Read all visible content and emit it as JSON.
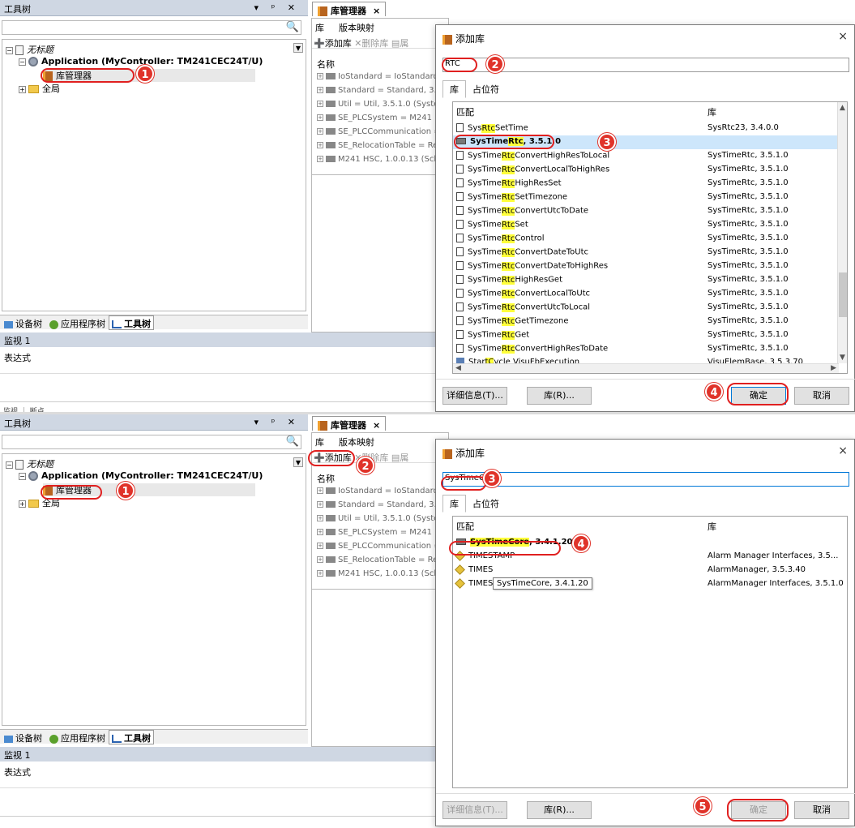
{
  "shared": {
    "tool_tree_title": "工具树",
    "pin_close": "▾  ᵖ  ✕",
    "project_name": "无标题",
    "application_node": "Application (MyController: TM241CEC24T/U)",
    "library_manager_node": "库管理器",
    "global_node": "全局",
    "tab_device_tree": "设备树",
    "tab_app_tree": "应用程序树",
    "tab_tool_tree": "工具树",
    "watch_title": "监视 1",
    "watch_col": "表达式",
    "lm_tab_title": "库管理器",
    "lm_subtab_lib": "库",
    "lm_subtab_version": "版本映射",
    "lm_add_lib": "添加库",
    "lm_remove_lib": "删除库",
    "lm_props": "属",
    "lm_name_header": "名称",
    "lm_items": [
      "IoStandard = IoStandard",
      "Standard = Standard, 3.5",
      "Util = Util, 3.5.1.0 (Syster",
      "SE_PLCSystem = M241 Pl",
      "SE_PLCCommunication =",
      "SE_RelocationTable = Re",
      "M241 HSC, 1.0.0.13 (Schn"
    ],
    "dlg_title": "添加库",
    "dlg_close": "×",
    "dlg_tab_lib": "库",
    "dlg_tab_placeholder": "占位符",
    "col_match": "匹配",
    "col_lib": "库",
    "btn_details": "详细信息(T)...",
    "btn_lib": "库(R)...",
    "btn_ok": "确定",
    "btn_cancel": "取消"
  },
  "panel1": {
    "search_text": "RTC",
    "rows": [
      {
        "icon": "doc",
        "pre": "Sys",
        "hl": "Rtc",
        "post": "SetTime",
        "lib": "SysRtc23, 3.4.0.0",
        "sel": false,
        "bold": false
      },
      {
        "icon": "lib",
        "pre": "SysTime",
        "hl": "Rtc",
        "post": ", 3.5.1.0",
        "lib": "",
        "sel": true,
        "bold": true
      },
      {
        "icon": "doc",
        "pre": "SysTime",
        "hl": "Rtc",
        "post": "ConvertHighResToLocal",
        "lib": "SysTimeRtc, 3.5.1.0",
        "sel": false,
        "bold": false
      },
      {
        "icon": "doc",
        "pre": "SysTime",
        "hl": "Rtc",
        "post": "ConvertLocalToHighRes",
        "lib": "SysTimeRtc, 3.5.1.0",
        "sel": false,
        "bold": false
      },
      {
        "icon": "doc",
        "pre": "SysTime",
        "hl": "Rtc",
        "post": "HighResSet",
        "lib": "SysTimeRtc, 3.5.1.0",
        "sel": false,
        "bold": false
      },
      {
        "icon": "doc",
        "pre": "SysTime",
        "hl": "Rtc",
        "post": "SetTimezone",
        "lib": "SysTimeRtc, 3.5.1.0",
        "sel": false,
        "bold": false
      },
      {
        "icon": "doc",
        "pre": "SysTime",
        "hl": "Rtc",
        "post": "ConvertUtcToDate",
        "lib": "SysTimeRtc, 3.5.1.0",
        "sel": false,
        "bold": false
      },
      {
        "icon": "doc",
        "pre": "SysTime",
        "hl": "Rtc",
        "post": "Set",
        "lib": "SysTimeRtc, 3.5.1.0",
        "sel": false,
        "bold": false
      },
      {
        "icon": "doc",
        "pre": "SysTime",
        "hl": "Rtc",
        "post": "Control",
        "lib": "SysTimeRtc, 3.5.1.0",
        "sel": false,
        "bold": false
      },
      {
        "icon": "doc",
        "pre": "SysTime",
        "hl": "Rtc",
        "post": "ConvertDateToUtc",
        "lib": "SysTimeRtc, 3.5.1.0",
        "sel": false,
        "bold": false
      },
      {
        "icon": "doc",
        "pre": "SysTime",
        "hl": "Rtc",
        "post": "ConvertDateToHighRes",
        "lib": "SysTimeRtc, 3.5.1.0",
        "sel": false,
        "bold": false
      },
      {
        "icon": "doc",
        "pre": "SysTime",
        "hl": "Rtc",
        "post": "HighResGet",
        "lib": "SysTimeRtc, 3.5.1.0",
        "sel": false,
        "bold": false
      },
      {
        "icon": "doc",
        "pre": "SysTime",
        "hl": "Rtc",
        "post": "ConvertLocalToUtc",
        "lib": "SysTimeRtc, 3.5.1.0",
        "sel": false,
        "bold": false
      },
      {
        "icon": "doc",
        "pre": "SysTime",
        "hl": "Rtc",
        "post": "ConvertUtcToLocal",
        "lib": "SysTimeRtc, 3.5.1.0",
        "sel": false,
        "bold": false
      },
      {
        "icon": "doc",
        "pre": "SysTime",
        "hl": "Rtc",
        "post": "GetTimezone",
        "lib": "SysTimeRtc, 3.5.1.0",
        "sel": false,
        "bold": false
      },
      {
        "icon": "doc",
        "pre": "SysTime",
        "hl": "Rtc",
        "post": "Get",
        "lib": "SysTimeRtc, 3.5.1.0",
        "sel": false,
        "bold": false
      },
      {
        "icon": "doc",
        "pre": "SysTime",
        "hl": "Rtc",
        "post": "ConvertHighResToDate",
        "lib": "SysTimeRtc, 3.5.1.0",
        "sel": false,
        "bold": false
      },
      {
        "icon": "fb",
        "pre": "Star",
        "hl": "tC",
        "post": "ycle   VisuFbExecution",
        "lib": "VisuElemBase, 3.5.3.70",
        "sel": false,
        "bold": false
      }
    ],
    "markers": [
      "1",
      "2",
      "3",
      "4"
    ]
  },
  "panel2": {
    "search_text": "SysTimeCore",
    "rows": [
      {
        "icon": "lib",
        "pre": "",
        "hl": "SysTimeCore",
        "post": ", 3.4.1.20",
        "lib": "",
        "sel": false,
        "bold": true
      },
      {
        "icon": "tag",
        "pre": "TIMESTAMP",
        "hl": "",
        "post": "",
        "lib": "Alarm Manager Interfaces, 3.5...",
        "sel": false,
        "bold": false
      },
      {
        "icon": "tag",
        "pre": "TIMES",
        "hl": "",
        "post": "",
        "lib": "AlarmManager, 3.5.3.40",
        "sel": false,
        "bold": false
      },
      {
        "icon": "tag",
        "pre": "TIMESTAMP",
        "hl": "",
        "post": "",
        "lib": "AlarmManager Interfaces, 3.5.1.0",
        "sel": false,
        "bold": false
      }
    ],
    "tooltip": "SysTimeCore, 3.4.1.20",
    "markers": [
      "1",
      "2",
      "3",
      "4",
      "5"
    ]
  },
  "cut_tabs_text": "监视 ｜ 断点"
}
